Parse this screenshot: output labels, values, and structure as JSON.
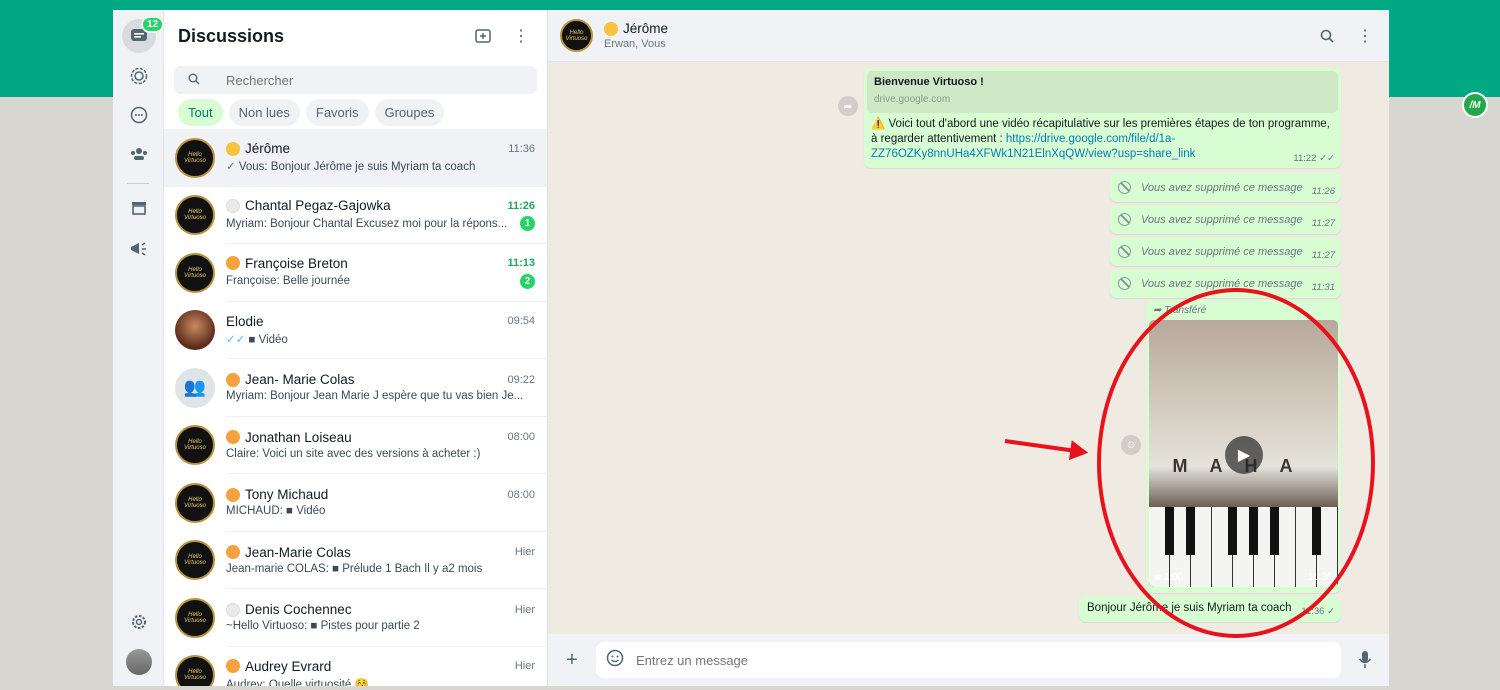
{
  "nav": {
    "status_badge": "12",
    "icons": [
      "chats-icon",
      "status-icon",
      "channels-icon",
      "communities-icon",
      "store-icon",
      "broadcast-icon",
      "settings-icon"
    ]
  },
  "sidebar": {
    "title": "Discussions",
    "search_placeholder": "Rechercher",
    "filters": [
      "Tout",
      "Non lues",
      "Favoris",
      "Groupes"
    ],
    "chats": [
      {
        "name": "Jérôme",
        "time": "11:36",
        "preview": "Vous: Bonjour Jérôme je suis Myriam ta coach",
        "tick": "✓",
        "unread": "",
        "dot": "y",
        "avatar": "hv"
      },
      {
        "name": "Chantal Pegaz-Gajowka",
        "time": "11:26",
        "preview": "Myriam: Bonjour Chantal  Excusez moi pour la répons...",
        "tick": "",
        "unread": "1",
        "dot": "g",
        "avatar": "hv"
      },
      {
        "name": "Françoise Breton",
        "time": "11:13",
        "preview": "Françoise: Belle journée",
        "tick": "",
        "unread": "2",
        "dot": "o",
        "avatar": "hv"
      },
      {
        "name": "Elodie",
        "time": "09:54",
        "preview": "■ Vidéo",
        "tick": "✓✓",
        "unread": "",
        "dot": "",
        "avatar": "photo"
      },
      {
        "name": "Jean- Marie Colas",
        "time": "09:22",
        "preview": "Myriam: Bonjour Jean Marie  J espère que tu vas bien  Je...",
        "tick": "",
        "unread": "",
        "dot": "o",
        "avatar": "group"
      },
      {
        "name": "Jonathan Loiseau",
        "time": "08:00",
        "preview": "Claire: Voici un site avec des versions à acheter :)",
        "tick": "",
        "unread": "",
        "dot": "o",
        "avatar": "hv"
      },
      {
        "name": "Tony Michaud",
        "time": "08:00",
        "preview": "MICHAUD: ■ Vidéo",
        "tick": "",
        "unread": "",
        "dot": "o",
        "avatar": "hv"
      },
      {
        "name": "Jean-Marie Colas",
        "time": "Hier",
        "preview": "Jean-marie COLAS: ■ Prélude 1 Bach Il y a2 mois",
        "tick": "",
        "unread": "",
        "dot": "o",
        "avatar": "hv"
      },
      {
        "name": "Denis Cochennec",
        "time": "Hier",
        "preview": "~Hello Virtuoso: ■ Pistes pour partie 2",
        "tick": "",
        "unread": "",
        "dot": "g",
        "avatar": "hv"
      },
      {
        "name": "Audrey Evrard",
        "time": "Hier",
        "preview": "Audrey: Quelle virtuosité 😚",
        "tick": "",
        "unread": "",
        "dot": "o",
        "avatar": "hv"
      }
    ]
  },
  "chat": {
    "name": "Jérôme",
    "subtitle": "Erwan, Vous",
    "card": {
      "title": "Bienvenue Virtuoso !",
      "domain": "drive.google.com",
      "text": "⚠️ Voici tout d'abord une vidéo récapitulative sur les premières étapes de ton programme, à regarder attentivement : ",
      "link": "https://drive.google.com/file/d/1a-ZZ76OZKy8nnUHa4XFWk1N21ElnXqQW/view?usp=share_link",
      "time": "11:22"
    },
    "deleted": [
      {
        "text": "Vous avez supprimé ce message",
        "time": "11:26"
      },
      {
        "text": "Vous avez supprimé ce message",
        "time": "11:27"
      },
      {
        "text": "Vous avez supprimé ce message",
        "time": "11:27"
      },
      {
        "text": "Vous avez supprimé ce message",
        "time": "11:31"
      }
    ],
    "forward": {
      "label": "Transféré",
      "duration": "1:00",
      "time": "11:36",
      "video_text": "MAHA"
    },
    "last_message": {
      "text": "Bonjour Jérôme je suis Myriam ta coach",
      "time": "11:36"
    },
    "composer_placeholder": "Entrez un message"
  },
  "extension": {
    "label": "/M"
  },
  "colors": {
    "brand": "#00a884",
    "bubble_out": "#d9fdd3",
    "annotation": "#e8121c",
    "unread": "#25d366"
  }
}
